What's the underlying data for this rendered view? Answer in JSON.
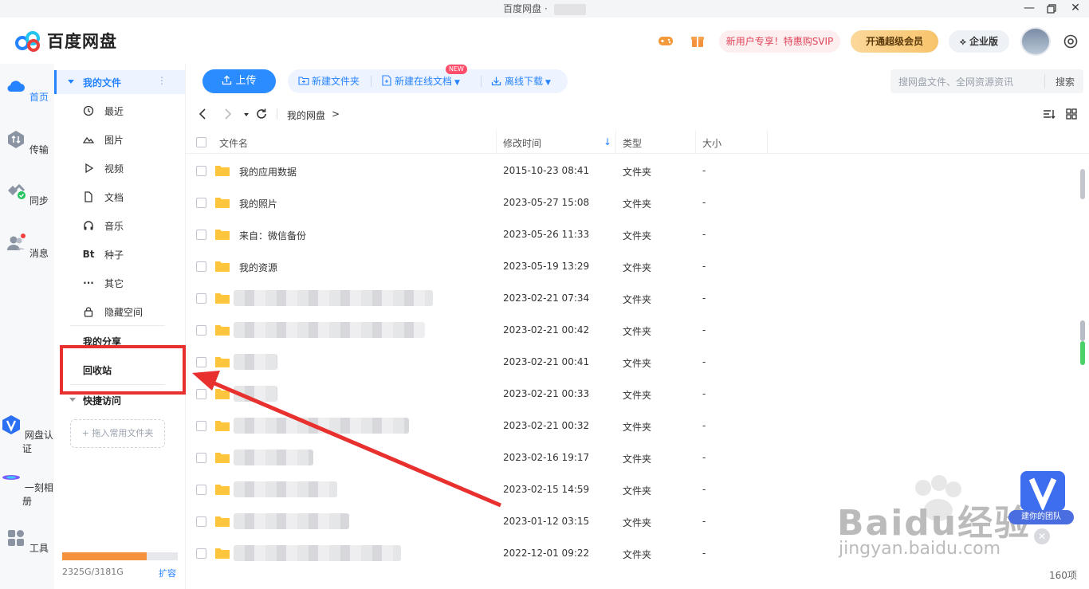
{
  "window": {
    "title": "百度网盘 ·"
  },
  "header": {
    "app_name": "百度网盘",
    "promo_text": "新用户专享！特惠购SVIP",
    "vip_button": "开通超级会员",
    "enterprise_button": "企业版"
  },
  "rail": {
    "items": [
      {
        "label": "首页"
      },
      {
        "label": "传输"
      },
      {
        "label": "同步"
      },
      {
        "label": "消息"
      },
      {
        "label": "网盘认证"
      },
      {
        "label": "一刻相册"
      },
      {
        "label": "工具"
      }
    ]
  },
  "sidebar": {
    "my_files": "我的文件",
    "categories": [
      {
        "label": "最近",
        "icon": "clock-icon"
      },
      {
        "label": "图片",
        "icon": "mountain-icon"
      },
      {
        "label": "视频",
        "icon": "play-icon"
      },
      {
        "label": "文档",
        "icon": "document-icon"
      },
      {
        "label": "音乐",
        "icon": "headphones-icon"
      },
      {
        "label": "种子",
        "icon_text": "Bt"
      },
      {
        "label": "其它",
        "icon_text": "···"
      },
      {
        "label": "隐藏空间",
        "icon": "lock-icon"
      }
    ],
    "my_share": "我的分享",
    "recycle_bin": "回收站",
    "quick_access": "快捷访问",
    "drop_hint": "+ 拖入常用文件夹",
    "quota_text": "2325G/3181G",
    "quota_used": 2325,
    "quota_total": 3181,
    "expand": "扩容"
  },
  "toolbar": {
    "upload": "上传",
    "new_folder": "新建文件夹",
    "new_online_doc": "新建在线文档",
    "new_badge": "NEW",
    "offline_download": "离线下载",
    "search_placeholder": "搜网盘文件、全网资源资讯",
    "search_button": "搜索"
  },
  "breadcrumb": {
    "root": "我的网盘",
    "sep": ">"
  },
  "table": {
    "columns": [
      "文件名",
      "修改时间",
      "类型",
      "大小"
    ],
    "rows": [
      {
        "name": "我的应用数据",
        "mtime": "2015-10-23 08:41",
        "type": "文件夹",
        "size": "-"
      },
      {
        "name": "我的照片",
        "mtime": "2023-05-27 15:08",
        "type": "文件夹",
        "size": "-"
      },
      {
        "name": "来自：微信备份",
        "mtime": "2023-05-26 11:33",
        "type": "文件夹",
        "size": "-"
      },
      {
        "name": "我的资源",
        "mtime": "2023-05-19 13:29",
        "type": "文件夹",
        "size": "-"
      },
      {
        "name": "",
        "mtime": "2023-02-21 07:34",
        "type": "文件夹",
        "size": "-"
      },
      {
        "name": "",
        "mtime": "2023-02-21 00:42",
        "type": "文件夹",
        "size": "-"
      },
      {
        "name": "",
        "mtime": "2023-02-21 00:41",
        "type": "文件夹",
        "size": "-"
      },
      {
        "name": "",
        "mtime": "2023-02-21 00:33",
        "type": "文件夹",
        "size": "-"
      },
      {
        "name": "",
        "mtime": "2023-02-21 00:32",
        "type": "文件夹",
        "size": "-"
      },
      {
        "name": "",
        "mtime": "2023-02-16 19:17",
        "type": "文件夹",
        "size": "-"
      },
      {
        "name": "",
        "mtime": "2023-02-15 14:59",
        "type": "文件夹",
        "size": "-"
      },
      {
        "name": "",
        "mtime": "2023-01-12 03:15",
        "type": "文件夹",
        "size": "-"
      },
      {
        "name": "",
        "mtime": "2022-12-01 09:22",
        "type": "文件夹",
        "size": "-"
      }
    ]
  },
  "footer": {
    "count": "160项"
  },
  "overlay": {
    "badge_label": "建你的团队",
    "watermark": "Baidu经验",
    "watermark_url": "jingyan.baidu.com"
  },
  "colors": {
    "accent": "#2683ff",
    "annotation": "#e8302e",
    "folder": "#ffc53d",
    "quota": "#f5923e"
  }
}
